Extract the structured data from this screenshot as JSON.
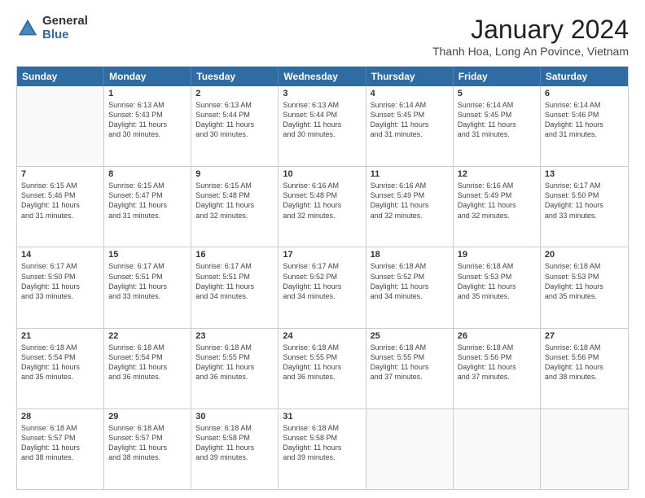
{
  "logo": {
    "general": "General",
    "blue": "Blue"
  },
  "title": "January 2024",
  "location": "Thanh Hoa, Long An Povince, Vietnam",
  "header": {
    "days": [
      "Sunday",
      "Monday",
      "Tuesday",
      "Wednesday",
      "Thursday",
      "Friday",
      "Saturday"
    ]
  },
  "weeks": [
    [
      {
        "day": "",
        "empty": true,
        "lines": []
      },
      {
        "day": "1",
        "lines": [
          "Sunrise: 6:13 AM",
          "Sunset: 5:43 PM",
          "Daylight: 11 hours",
          "and 30 minutes."
        ]
      },
      {
        "day": "2",
        "lines": [
          "Sunrise: 6:13 AM",
          "Sunset: 5:44 PM",
          "Daylight: 11 hours",
          "and 30 minutes."
        ]
      },
      {
        "day": "3",
        "lines": [
          "Sunrise: 6:13 AM",
          "Sunset: 5:44 PM",
          "Daylight: 11 hours",
          "and 30 minutes."
        ]
      },
      {
        "day": "4",
        "lines": [
          "Sunrise: 6:14 AM",
          "Sunset: 5:45 PM",
          "Daylight: 11 hours",
          "and 31 minutes."
        ]
      },
      {
        "day": "5",
        "lines": [
          "Sunrise: 6:14 AM",
          "Sunset: 5:45 PM",
          "Daylight: 11 hours",
          "and 31 minutes."
        ]
      },
      {
        "day": "6",
        "lines": [
          "Sunrise: 6:14 AM",
          "Sunset: 5:46 PM",
          "Daylight: 11 hours",
          "and 31 minutes."
        ]
      }
    ],
    [
      {
        "day": "7",
        "lines": [
          "Sunrise: 6:15 AM",
          "Sunset: 5:46 PM",
          "Daylight: 11 hours",
          "and 31 minutes."
        ]
      },
      {
        "day": "8",
        "lines": [
          "Sunrise: 6:15 AM",
          "Sunset: 5:47 PM",
          "Daylight: 11 hours",
          "and 31 minutes."
        ]
      },
      {
        "day": "9",
        "lines": [
          "Sunrise: 6:15 AM",
          "Sunset: 5:48 PM",
          "Daylight: 11 hours",
          "and 32 minutes."
        ]
      },
      {
        "day": "10",
        "lines": [
          "Sunrise: 6:16 AM",
          "Sunset: 5:48 PM",
          "Daylight: 11 hours",
          "and 32 minutes."
        ]
      },
      {
        "day": "11",
        "lines": [
          "Sunrise: 6:16 AM",
          "Sunset: 5:49 PM",
          "Daylight: 11 hours",
          "and 32 minutes."
        ]
      },
      {
        "day": "12",
        "lines": [
          "Sunrise: 6:16 AM",
          "Sunset: 5:49 PM",
          "Daylight: 11 hours",
          "and 32 minutes."
        ]
      },
      {
        "day": "13",
        "lines": [
          "Sunrise: 6:17 AM",
          "Sunset: 5:50 PM",
          "Daylight: 11 hours",
          "and 33 minutes."
        ]
      }
    ],
    [
      {
        "day": "14",
        "lines": [
          "Sunrise: 6:17 AM",
          "Sunset: 5:50 PM",
          "Daylight: 11 hours",
          "and 33 minutes."
        ]
      },
      {
        "day": "15",
        "lines": [
          "Sunrise: 6:17 AM",
          "Sunset: 5:51 PM",
          "Daylight: 11 hours",
          "and 33 minutes."
        ]
      },
      {
        "day": "16",
        "lines": [
          "Sunrise: 6:17 AM",
          "Sunset: 5:51 PM",
          "Daylight: 11 hours",
          "and 34 minutes."
        ]
      },
      {
        "day": "17",
        "lines": [
          "Sunrise: 6:17 AM",
          "Sunset: 5:52 PM",
          "Daylight: 11 hours",
          "and 34 minutes."
        ]
      },
      {
        "day": "18",
        "lines": [
          "Sunrise: 6:18 AM",
          "Sunset: 5:52 PM",
          "Daylight: 11 hours",
          "and 34 minutes."
        ]
      },
      {
        "day": "19",
        "lines": [
          "Sunrise: 6:18 AM",
          "Sunset: 5:53 PM",
          "Daylight: 11 hours",
          "and 35 minutes."
        ]
      },
      {
        "day": "20",
        "lines": [
          "Sunrise: 6:18 AM",
          "Sunset: 5:53 PM",
          "Daylight: 11 hours",
          "and 35 minutes."
        ]
      }
    ],
    [
      {
        "day": "21",
        "lines": [
          "Sunrise: 6:18 AM",
          "Sunset: 5:54 PM",
          "Daylight: 11 hours",
          "and 35 minutes."
        ]
      },
      {
        "day": "22",
        "lines": [
          "Sunrise: 6:18 AM",
          "Sunset: 5:54 PM",
          "Daylight: 11 hours",
          "and 36 minutes."
        ]
      },
      {
        "day": "23",
        "lines": [
          "Sunrise: 6:18 AM",
          "Sunset: 5:55 PM",
          "Daylight: 11 hours",
          "and 36 minutes."
        ]
      },
      {
        "day": "24",
        "lines": [
          "Sunrise: 6:18 AM",
          "Sunset: 5:55 PM",
          "Daylight: 11 hours",
          "and 36 minutes."
        ]
      },
      {
        "day": "25",
        "lines": [
          "Sunrise: 6:18 AM",
          "Sunset: 5:55 PM",
          "Daylight: 11 hours",
          "and 37 minutes."
        ]
      },
      {
        "day": "26",
        "lines": [
          "Sunrise: 6:18 AM",
          "Sunset: 5:56 PM",
          "Daylight: 11 hours",
          "and 37 minutes."
        ]
      },
      {
        "day": "27",
        "lines": [
          "Sunrise: 6:18 AM",
          "Sunset: 5:56 PM",
          "Daylight: 11 hours",
          "and 38 minutes."
        ]
      }
    ],
    [
      {
        "day": "28",
        "lines": [
          "Sunrise: 6:18 AM",
          "Sunset: 5:57 PM",
          "Daylight: 11 hours",
          "and 38 minutes."
        ]
      },
      {
        "day": "29",
        "lines": [
          "Sunrise: 6:18 AM",
          "Sunset: 5:57 PM",
          "Daylight: 11 hours",
          "and 38 minutes."
        ]
      },
      {
        "day": "30",
        "lines": [
          "Sunrise: 6:18 AM",
          "Sunset: 5:58 PM",
          "Daylight: 11 hours",
          "and 39 minutes."
        ]
      },
      {
        "day": "31",
        "lines": [
          "Sunrise: 6:18 AM",
          "Sunset: 5:58 PM",
          "Daylight: 11 hours",
          "and 39 minutes."
        ]
      },
      {
        "day": "",
        "empty": true,
        "lines": []
      },
      {
        "day": "",
        "empty": true,
        "lines": []
      },
      {
        "day": "",
        "empty": true,
        "lines": []
      }
    ]
  ]
}
